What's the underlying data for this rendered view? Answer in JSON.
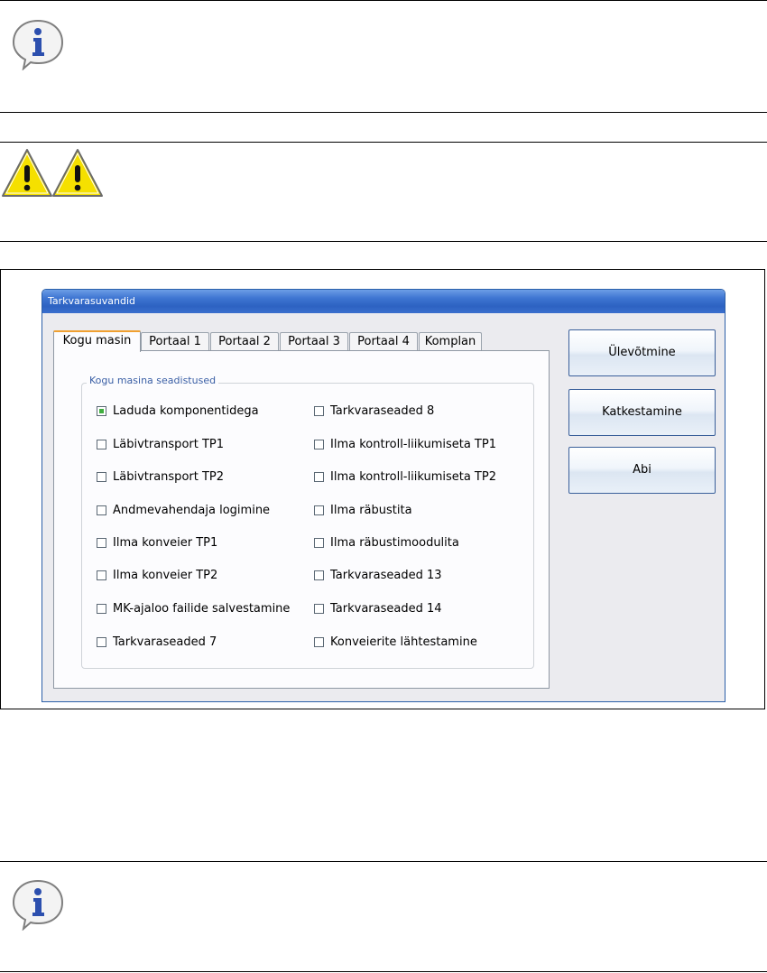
{
  "window": {
    "title": "Tarkvarasuvandid"
  },
  "tabs": [
    {
      "label": "Kogu masin",
      "active": true
    },
    {
      "label": "Portaal 1",
      "active": false
    },
    {
      "label": "Portaal 2",
      "active": false
    },
    {
      "label": "Portaal 3",
      "active": false
    },
    {
      "label": "Portaal 4",
      "active": false
    },
    {
      "label": "Komplan",
      "active": false
    }
  ],
  "group": {
    "legend": "Kogu masina seadistused"
  },
  "options_left": [
    {
      "label": "Laduda komponentidega",
      "checked": true
    },
    {
      "label": "Läbivtransport TP1",
      "checked": false
    },
    {
      "label": "Läbivtransport TP2",
      "checked": false
    },
    {
      "label": "Andmevahendaja logimine",
      "checked": false
    },
    {
      "label": "Ilma konveier TP1",
      "checked": false
    },
    {
      "label": "Ilma konveier TP2",
      "checked": false
    },
    {
      "label": "MK-ajaloo failide salvestamine",
      "checked": false
    },
    {
      "label": "Tarkvaraseaded 7",
      "checked": false
    }
  ],
  "options_right": [
    {
      "label": "Tarkvaraseaded 8",
      "checked": false
    },
    {
      "label": "Ilma kontroll-liikumiseta TP1",
      "checked": false
    },
    {
      "label": "Ilma kontroll-liikumiseta TP2",
      "checked": false
    },
    {
      "label": "Ilma räbustita",
      "checked": false
    },
    {
      "label": "Ilma räbustimoodulita",
      "checked": false
    },
    {
      "label": "Tarkvaraseaded 13",
      "checked": false
    },
    {
      "label": "Tarkvaraseaded 14",
      "checked": false
    },
    {
      "label": "Konveierite lähtestamine",
      "checked": false
    }
  ],
  "buttons": {
    "accept": "Ülevõtmine",
    "cancel": "Katkestamine",
    "help": "Abi"
  },
  "colors": {
    "titlebar": "#3f76d2",
    "tab_accent": "#f0a030",
    "checked_fill": "#3fae3f",
    "legend_text": "#3a5fa5"
  },
  "icons": [
    "info-icon",
    "warning-icon",
    "warning-icon",
    "info-icon"
  ]
}
